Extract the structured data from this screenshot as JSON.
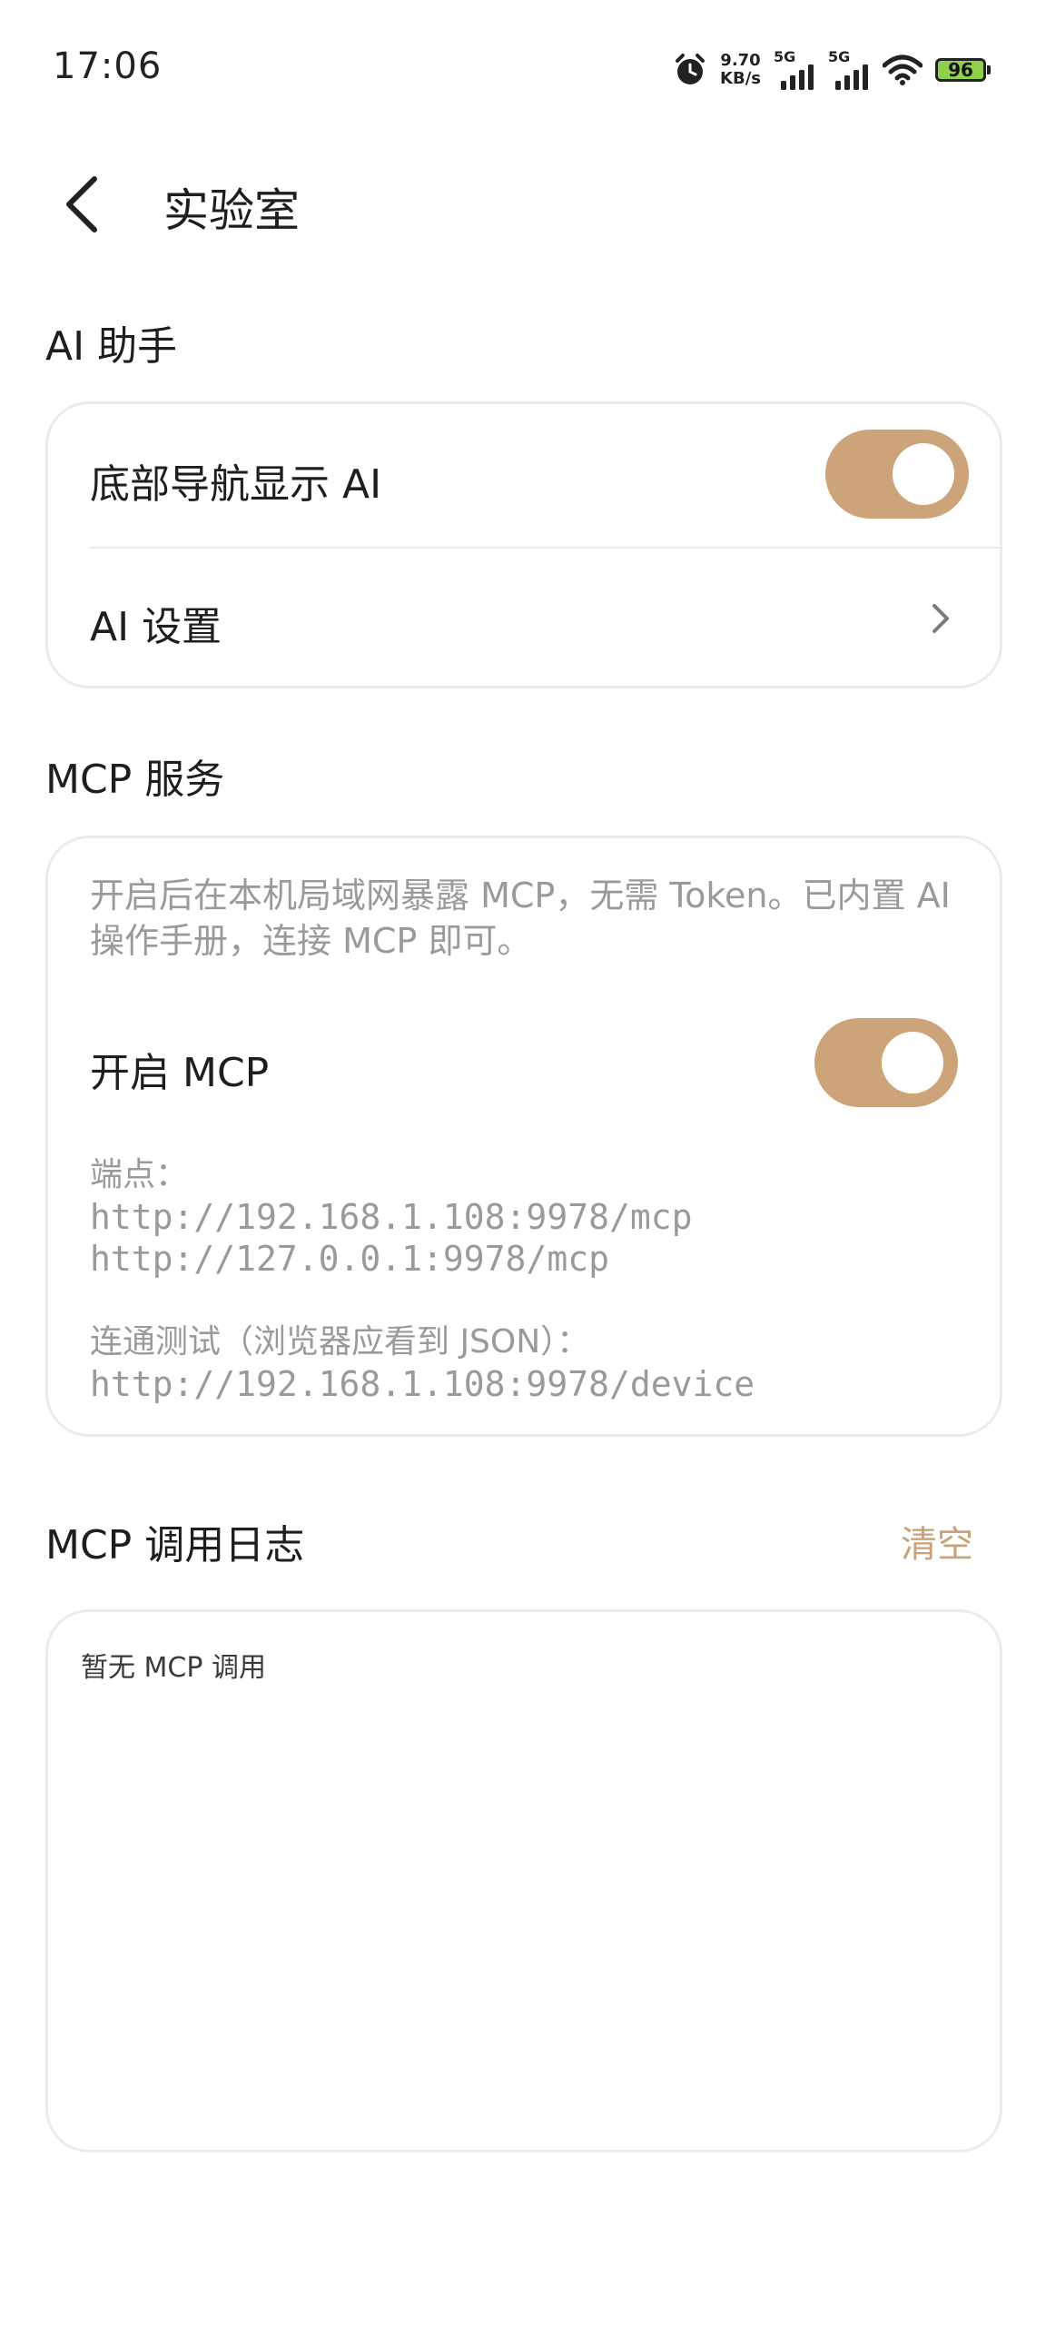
{
  "status_bar": {
    "time": "17:06",
    "net_speed_value": "9.70",
    "net_speed_unit": "KB/s",
    "sim1_tag": "5G",
    "sim2_tag": "5G",
    "battery_level": "96",
    "icons": [
      "alarm-icon",
      "signal-icon",
      "signal-icon",
      "wifi-icon",
      "battery-icon"
    ]
  },
  "header": {
    "title": "实验室",
    "back_icon": "chevron-left-icon"
  },
  "ai_section": {
    "title": "AI 助手",
    "show_ai_in_nav": {
      "label": "底部导航显示 AI",
      "enabled": true
    },
    "ai_settings": {
      "label": "AI 设置",
      "icon": "chevron-right-icon"
    }
  },
  "mcp_section": {
    "title": "MCP 服务",
    "description": "开启后在本机局域网暴露 MCP，无需 Token。已内置 AI 操作手册，连接 MCP 即可。",
    "enable": {
      "label": "开启 MCP",
      "enabled": true
    },
    "endpoints_label": "端点：",
    "endpoints": [
      "http://192.168.1.108:9978/mcp",
      "http://127.0.0.1:9978/mcp"
    ],
    "test_label": "连通测试（浏览器应看到 JSON）：",
    "test_url": "http://192.168.1.108:9978/device"
  },
  "log_section": {
    "title": "MCP 调用日志",
    "clear_label": "清空",
    "empty_text": "暂无 MCP 调用"
  },
  "colors": {
    "accent": "#cda479",
    "accent_text": "#c9a278",
    "muted_text": "#9a9a9a",
    "card_border": "#ececec"
  }
}
